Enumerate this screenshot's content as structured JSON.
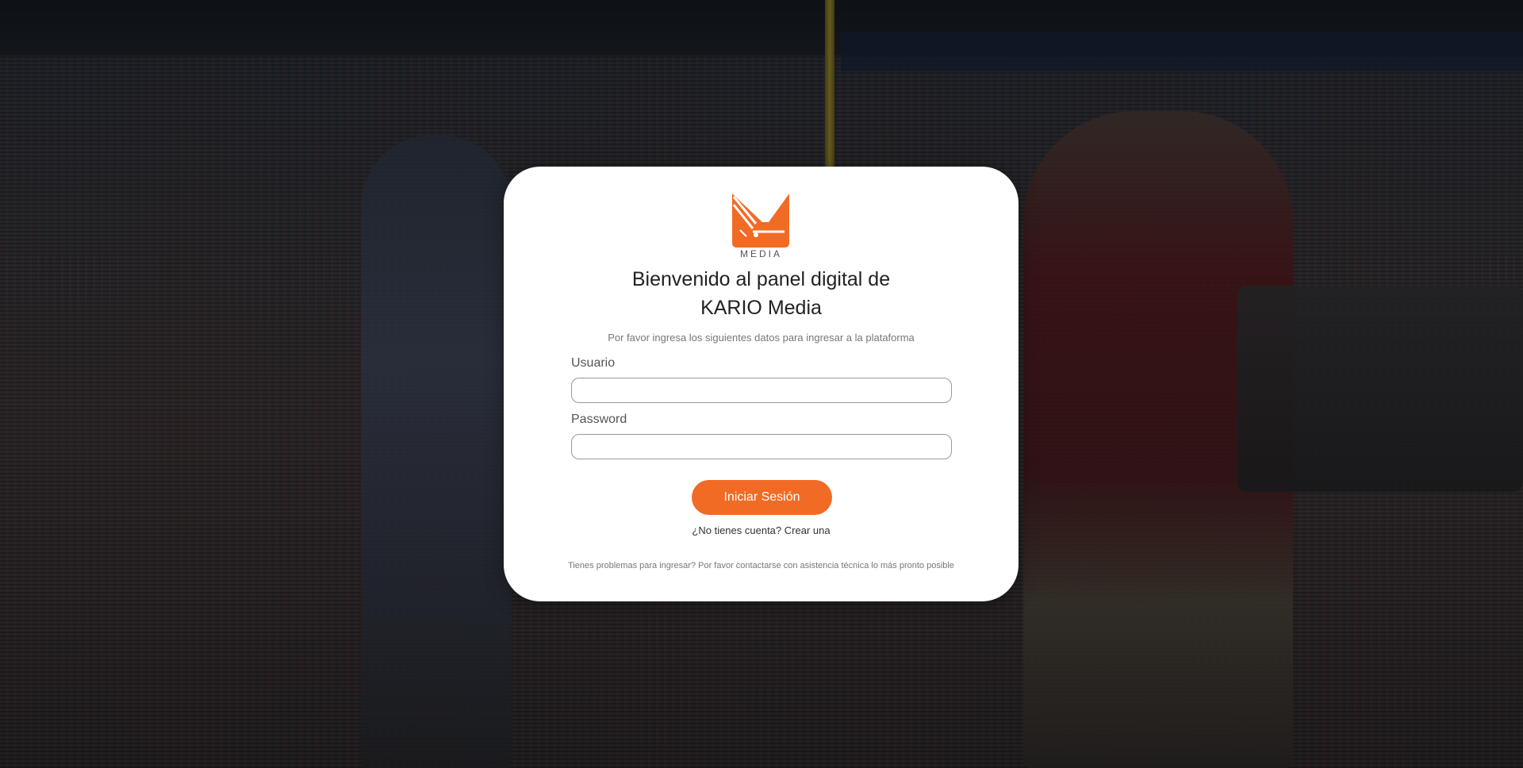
{
  "brand": {
    "logo_icon": "kario-k-logo-icon",
    "logo_text": "MEDIA",
    "accent_color": "#f26b25"
  },
  "login": {
    "title_line1": "Bienvenido al panel digital de",
    "title_line2": "KARIO Media",
    "subtitle": "Por favor ingresa los siguientes datos para ingresar a la plataforma",
    "username_label": "Usuario",
    "username_value": "",
    "password_label": "Password",
    "password_value": "",
    "submit_label": "Iniciar Sesión",
    "signup_prompt": "¿No tienes cuenta?",
    "signup_link": "Crear una",
    "help_text": "Tienes problemas para ingresar? Por favor contactarse con asistencia técnica lo más pronto posible"
  }
}
